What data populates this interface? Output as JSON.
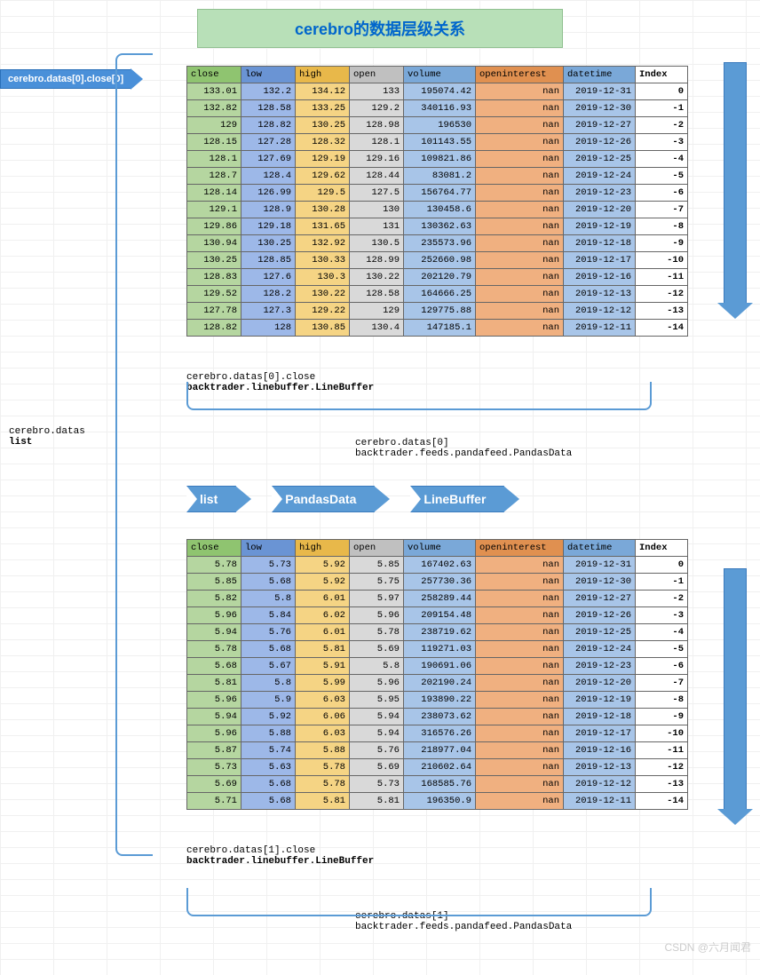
{
  "title": "cerebro的数据层级关系",
  "pointer_label": "cerebro.datas[0].close[0]",
  "left_label_line1": "cerebro.datas",
  "left_label_line2": "list",
  "headers": {
    "close": "close",
    "low": "low",
    "high": "high",
    "open": "open",
    "volume": "volume",
    "oi": "openinterest",
    "dt": "datetime",
    "index": "Index"
  },
  "table1_rows": [
    {
      "close": "133.01",
      "low": "132.2",
      "high": "134.12",
      "open": "133",
      "volume": "195074.42",
      "oi": "nan",
      "dt": "2019-12-31",
      "idx": "0"
    },
    {
      "close": "132.82",
      "low": "128.58",
      "high": "133.25",
      "open": "129.2",
      "volume": "340116.93",
      "oi": "nan",
      "dt": "2019-12-30",
      "idx": "-1"
    },
    {
      "close": "129",
      "low": "128.82",
      "high": "130.25",
      "open": "128.98",
      "volume": "196530",
      "oi": "nan",
      "dt": "2019-12-27",
      "idx": "-2"
    },
    {
      "close": "128.15",
      "low": "127.28",
      "high": "128.32",
      "open": "128.1",
      "volume": "101143.55",
      "oi": "nan",
      "dt": "2019-12-26",
      "idx": "-3"
    },
    {
      "close": "128.1",
      "low": "127.69",
      "high": "129.19",
      "open": "129.16",
      "volume": "109821.86",
      "oi": "nan",
      "dt": "2019-12-25",
      "idx": "-4"
    },
    {
      "close": "128.7",
      "low": "128.4",
      "high": "129.62",
      "open": "128.44",
      "volume": "83081.2",
      "oi": "nan",
      "dt": "2019-12-24",
      "idx": "-5"
    },
    {
      "close": "128.14",
      "low": "126.99",
      "high": "129.5",
      "open": "127.5",
      "volume": "156764.77",
      "oi": "nan",
      "dt": "2019-12-23",
      "idx": "-6"
    },
    {
      "close": "129.1",
      "low": "128.9",
      "high": "130.28",
      "open": "130",
      "volume": "130458.6",
      "oi": "nan",
      "dt": "2019-12-20",
      "idx": "-7"
    },
    {
      "close": "129.86",
      "low": "129.18",
      "high": "131.65",
      "open": "131",
      "volume": "130362.63",
      "oi": "nan",
      "dt": "2019-12-19",
      "idx": "-8"
    },
    {
      "close": "130.94",
      "low": "130.25",
      "high": "132.92",
      "open": "130.5",
      "volume": "235573.96",
      "oi": "nan",
      "dt": "2019-12-18",
      "idx": "-9"
    },
    {
      "close": "130.25",
      "low": "128.85",
      "high": "130.33",
      "open": "128.99",
      "volume": "252660.98",
      "oi": "nan",
      "dt": "2019-12-17",
      "idx": "-10"
    },
    {
      "close": "128.83",
      "low": "127.6",
      "high": "130.3",
      "open": "130.22",
      "volume": "202120.79",
      "oi": "nan",
      "dt": "2019-12-16",
      "idx": "-11"
    },
    {
      "close": "129.52",
      "low": "128.2",
      "high": "130.22",
      "open": "128.58",
      "volume": "164666.25",
      "oi": "nan",
      "dt": "2019-12-13",
      "idx": "-12"
    },
    {
      "close": "127.78",
      "low": "127.3",
      "high": "129.22",
      "open": "129",
      "volume": "129775.88",
      "oi": "nan",
      "dt": "2019-12-12",
      "idx": "-13"
    },
    {
      "close": "128.82",
      "low": "128",
      "high": "130.85",
      "open": "130.4",
      "volume": "147185.1",
      "oi": "nan",
      "dt": "2019-12-11",
      "idx": "-14"
    }
  ],
  "caption1_line1": "cerebro.datas[0].close",
  "caption1_line2": "backtrader.linebuffer.LineBuffer",
  "caption2_line1": "cerebro.datas[0]",
  "caption2_line2": "backtrader.feeds.pandafeed.PandasData",
  "flow": {
    "a1": "list",
    "a2": "PandasData",
    "a3": "LineBuffer"
  },
  "table2_rows": [
    {
      "close": "5.78",
      "low": "5.73",
      "high": "5.92",
      "open": "5.85",
      "volume": "167402.63",
      "oi": "nan",
      "dt": "2019-12-31",
      "idx": "0"
    },
    {
      "close": "5.85",
      "low": "5.68",
      "high": "5.92",
      "open": "5.75",
      "volume": "257730.36",
      "oi": "nan",
      "dt": "2019-12-30",
      "idx": "-1"
    },
    {
      "close": "5.82",
      "low": "5.8",
      "high": "6.01",
      "open": "5.97",
      "volume": "258289.44",
      "oi": "nan",
      "dt": "2019-12-27",
      "idx": "-2"
    },
    {
      "close": "5.96",
      "low": "5.84",
      "high": "6.02",
      "open": "5.96",
      "volume": "209154.48",
      "oi": "nan",
      "dt": "2019-12-26",
      "idx": "-3"
    },
    {
      "close": "5.94",
      "low": "5.76",
      "high": "6.01",
      "open": "5.78",
      "volume": "238719.62",
      "oi": "nan",
      "dt": "2019-12-25",
      "idx": "-4"
    },
    {
      "close": "5.78",
      "low": "5.68",
      "high": "5.81",
      "open": "5.69",
      "volume": "119271.03",
      "oi": "nan",
      "dt": "2019-12-24",
      "idx": "-5"
    },
    {
      "close": "5.68",
      "low": "5.67",
      "high": "5.91",
      "open": "5.8",
      "volume": "190691.06",
      "oi": "nan",
      "dt": "2019-12-23",
      "idx": "-6"
    },
    {
      "close": "5.81",
      "low": "5.8",
      "high": "5.99",
      "open": "5.96",
      "volume": "202190.24",
      "oi": "nan",
      "dt": "2019-12-20",
      "idx": "-7"
    },
    {
      "close": "5.96",
      "low": "5.9",
      "high": "6.03",
      "open": "5.95",
      "volume": "193890.22",
      "oi": "nan",
      "dt": "2019-12-19",
      "idx": "-8"
    },
    {
      "close": "5.94",
      "low": "5.92",
      "high": "6.06",
      "open": "5.94",
      "volume": "238073.62",
      "oi": "nan",
      "dt": "2019-12-18",
      "idx": "-9"
    },
    {
      "close": "5.96",
      "low": "5.88",
      "high": "6.03",
      "open": "5.94",
      "volume": "316576.26",
      "oi": "nan",
      "dt": "2019-12-17",
      "idx": "-10"
    },
    {
      "close": "5.87",
      "low": "5.74",
      "high": "5.88",
      "open": "5.76",
      "volume": "218977.04",
      "oi": "nan",
      "dt": "2019-12-16",
      "idx": "-11"
    },
    {
      "close": "5.73",
      "low": "5.63",
      "high": "5.78",
      "open": "5.69",
      "volume": "210602.64",
      "oi": "nan",
      "dt": "2019-12-13",
      "idx": "-12"
    },
    {
      "close": "5.69",
      "low": "5.68",
      "high": "5.78",
      "open": "5.73",
      "volume": "168585.76",
      "oi": "nan",
      "dt": "2019-12-12",
      "idx": "-13"
    },
    {
      "close": "5.71",
      "low": "5.68",
      "high": "5.81",
      "open": "5.81",
      "volume": "196350.9",
      "oi": "nan",
      "dt": "2019-12-11",
      "idx": "-14"
    }
  ],
  "caption3_line1": "cerebro.datas[1].close",
  "caption3_line2": "backtrader.linebuffer.LineBuffer",
  "caption4_line1": "cerebro.datas[1]",
  "caption4_line2": "backtrader.feeds.pandafeed.PandasData",
  "watermark": "CSDN @六月闻君"
}
